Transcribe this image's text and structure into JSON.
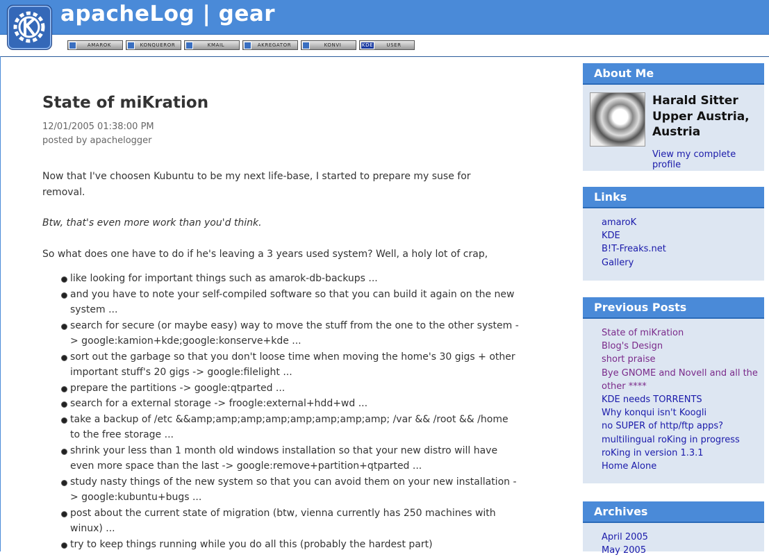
{
  "header": {
    "site_title": "apacheLog | gear",
    "logo_icon": "kde-gear-logo",
    "badges": [
      {
        "label": "AMAROK",
        "icon": "amarok-icon"
      },
      {
        "label": "KONQUEROR",
        "icon": "konqueror-icon"
      },
      {
        "label": "KMAIL",
        "icon": "kmail-icon"
      },
      {
        "label": "AKREGATOR",
        "icon": "akregator-icon"
      },
      {
        "label": "KONVI",
        "icon": "konversation-icon"
      },
      {
        "label": "USER",
        "icon": "kde-icon",
        "icon_text": "KDE"
      }
    ]
  },
  "post": {
    "title": "State of miKration",
    "date": "12/01/2005 01:38:00 PM",
    "author": "posted by apachelogger",
    "paragraphs": [
      "Now that I've choosen Kubuntu to be my next life-base, I started to prepare my suse for removal.",
      "Btw, that's even more work than you'd think.",
      "So what does one have to do if he's leaving a 3 years used system? Well, a holy lot of crap,"
    ],
    "bullets": [
      "like looking for important things such as amarok-db-backups ...",
      "and you have to note your self-compiled software so that you can build it again on the new system ...",
      "search for secure (or maybe easy) way to move the stuff from the one to the other system -> google:kamion+kde;google:konserve+kde ...",
      "sort out the garbage so that you don't loose time when moving the home's 30 gigs + other important stuff's 20 gigs -> google:filelight ...",
      "prepare the partitions -> google:qtparted ...",
      "search for a external storage -> froogle:external+hdd+wd ...",
      "take a backup of /etc &&amp;amp;amp;amp;amp;amp;amp;amp; /var && /root && /home to the free storage ...",
      "shrink your less than 1 month old windows installation so that your new distro will have even more space than the last -> google:remove+partition+qtparted ...",
      "study nasty things of the new system so that you can avoid them on your new installation -> google:kubuntu+bugs ...",
      "post about the current state of migration (btw, vienna currently has 250 machines with winux) ...",
      "try to keep things running while you do all this (probably the hardest part)"
    ]
  },
  "sidebar": {
    "about": {
      "heading": "About Me",
      "name": "Harald Sitter",
      "location_line1": "Upper Austria,",
      "location_line2": "Austria",
      "profile_link": "View my complete profile"
    },
    "links": {
      "heading": "Links",
      "items": [
        "amaroK",
        "KDE",
        "B!T-Freaks.net",
        "Gallery"
      ]
    },
    "previous": {
      "heading": "Previous Posts",
      "items": [
        {
          "label": "State of miKration",
          "visited": true
        },
        {
          "label": "Blog's Design",
          "visited": true
        },
        {
          "label": "short praise",
          "visited": true
        },
        {
          "label": "Bye GNOME and Novell and all the",
          "visited": true
        },
        {
          "label": "other ****",
          "visited": true
        },
        {
          "label": "KDE needs TORRENTS",
          "visited": false
        },
        {
          "label": "Why konqui isn't Koogli",
          "visited": false
        },
        {
          "label": "no SUPER of http/ftp apps?",
          "visited": false
        },
        {
          "label": "multilingual roKing in progress",
          "visited": false
        },
        {
          "label": "roKing in version 1.3.1",
          "visited": false
        },
        {
          "label": "Home Alone",
          "visited": false
        }
      ]
    },
    "archives": {
      "heading": "Archives",
      "items": [
        "April 2005",
        "May 2005"
      ]
    }
  },
  "colors": {
    "header_blue": "#4a8ad8",
    "sidebar_bg": "#dde6f2",
    "link": "#1a1aaa",
    "visited_link": "#7a2a8a"
  }
}
